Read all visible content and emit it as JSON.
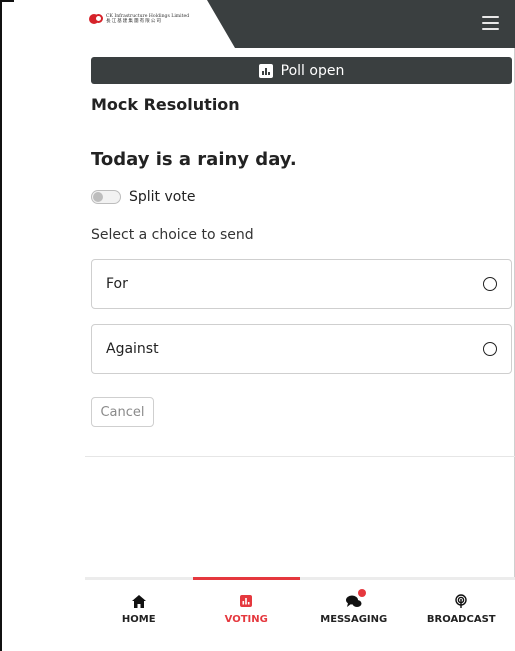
{
  "header": {
    "logo_en": "CK Infrastructure Holdings Limited",
    "logo_zh": "長江基建集團有限公司"
  },
  "poll": {
    "status_label": "Poll open"
  },
  "resolution": {
    "title": "Mock Resolution",
    "question": "Today is a rainy day."
  },
  "split_vote": {
    "label": "Split vote",
    "enabled": false
  },
  "select_prompt": "Select a choice to send",
  "choices": [
    {
      "label": "For"
    },
    {
      "label": "Against"
    }
  ],
  "cancel_label": "Cancel",
  "nav": {
    "items": [
      {
        "label": "HOME",
        "icon": "home-icon"
      },
      {
        "label": "VOTING",
        "icon": "poll-icon",
        "active": true
      },
      {
        "label": "MESSAGING",
        "icon": "chat-icon"
      },
      {
        "label": "BROADCAST",
        "icon": "broadcast-icon"
      }
    ]
  },
  "colors": {
    "header_dark": "#3a3f40",
    "accent_red": "#e5383e",
    "border": "#cfcfcf"
  }
}
